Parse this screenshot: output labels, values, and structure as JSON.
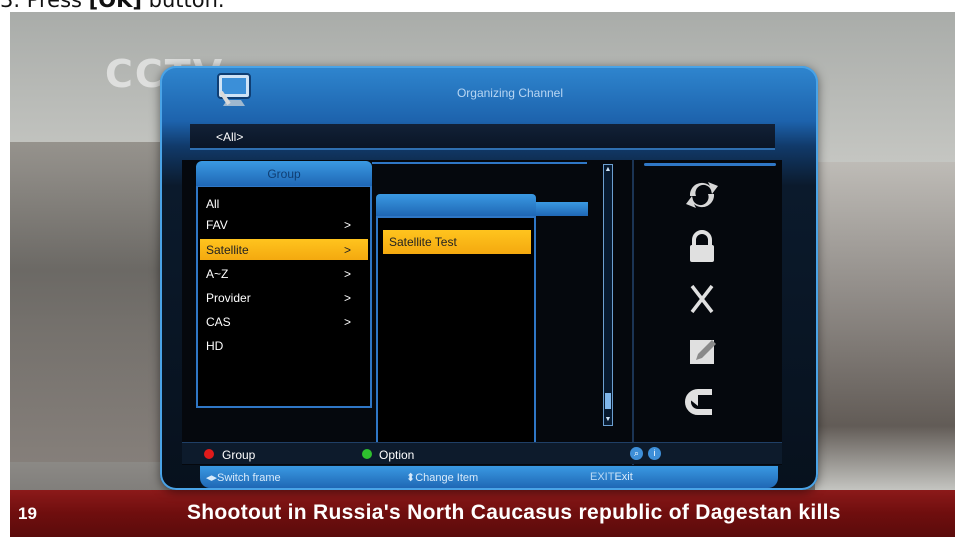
{
  "doc_instruction": {
    "prefix": "3.    Press ",
    "key": "[OK]",
    "suffix": " button."
  },
  "tv": {
    "ticker_number": "19",
    "ticker_text": "Shootout in Russia's North Caucasus republic of Dagestan kills"
  },
  "menu": {
    "title": "Organizing Channel",
    "path": "<All>",
    "group_header": "Group",
    "groups": [
      {
        "label": "All",
        "arrow": ""
      },
      {
        "label": "FAV",
        "arrow": ">"
      },
      {
        "label": "Satellite",
        "arrow": ">",
        "selected": true
      },
      {
        "label": "A~Z",
        "arrow": ">"
      },
      {
        "label": "Provider",
        "arrow": ">"
      },
      {
        "label": "CAS",
        "arrow": ">"
      },
      {
        "label": "HD",
        "arrow": ""
      }
    ],
    "satellites": [
      "Satellite Test"
    ],
    "tools": [
      "move-icon",
      "lock-icon",
      "delete-icon",
      "rename-icon",
      "undo-icon"
    ],
    "legend": {
      "red": "Group",
      "green": "Option"
    },
    "footer": {
      "switch": "Switch frame",
      "change": "Change Item",
      "exit_key": "EXIT",
      "exit_label": "Exit"
    },
    "colors": {
      "highlight": "#f4a90f",
      "accent": "#1f67b5"
    }
  }
}
